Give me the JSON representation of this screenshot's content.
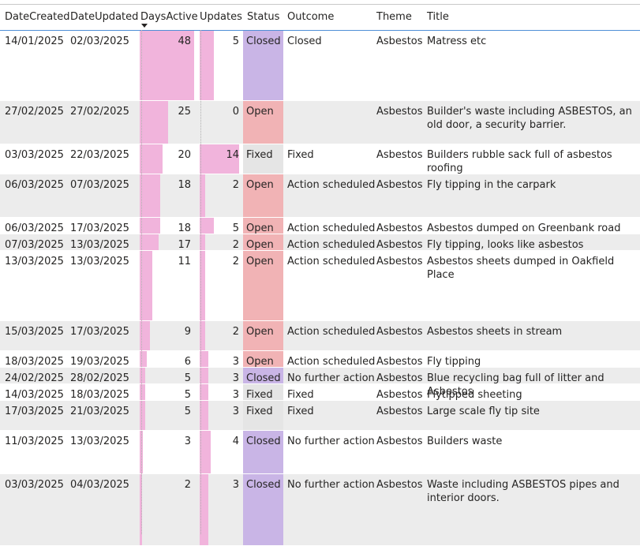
{
  "colors": {
    "bar": "#f1b4dc",
    "status_closed": "#c9b5e6",
    "status_open": "#f1b3b5",
    "status_fixed": "#e5e5e5",
    "row_alt": "#ececec",
    "header_rule": "#4f8fd6"
  },
  "headers": {
    "date_created": "DateCreated",
    "date_updated": "DateUpdated",
    "days_active": "DaysActive",
    "updates": "Updates",
    "status": "Status",
    "outcome": "Outcome",
    "theme": "Theme",
    "title": "Title"
  },
  "sort_indicator": "chevron-down-icon",
  "rows": [
    {
      "date_created": "14/01/2025",
      "date_updated": "02/03/2025",
      "days_active": "48",
      "updates": "5",
      "status": "Closed",
      "outcome": "Closed",
      "theme": "Asbestos",
      "title": "Matress etc"
    },
    {
      "date_created": "27/02/2025",
      "date_updated": "27/02/2025",
      "days_active": "25",
      "updates": "0",
      "status": "Open",
      "outcome": "",
      "theme": "Asbestos",
      "title": "Builder's waste including ASBESTOS, an old door, a security barrier."
    },
    {
      "date_created": "03/03/2025",
      "date_updated": "22/03/2025",
      "days_active": "20",
      "updates": "14",
      "status": "Fixed",
      "outcome": "Fixed",
      "theme": "Asbestos",
      "title": "Builders rubble sack full of asbestos roofing"
    },
    {
      "date_created": "06/03/2025",
      "date_updated": "07/03/2025",
      "days_active": "18",
      "updates": "2",
      "status": "Open",
      "outcome": "Action scheduled",
      "theme": "Asbestos",
      "title": "Fly tipping in the carpark"
    },
    {
      "date_created": "06/03/2025",
      "date_updated": "17/03/2025",
      "days_active": "18",
      "updates": "5",
      "status": "Open",
      "outcome": "Action scheduled",
      "theme": "Asbestos",
      "title": "Asbestos dumped on Greenbank road"
    },
    {
      "date_created": "07/03/2025",
      "date_updated": "13/03/2025",
      "days_active": "17",
      "updates": "2",
      "status": "Open",
      "outcome": "Action scheduled",
      "theme": "Asbestos",
      "title": "Fly tipping, looks like asbestos"
    },
    {
      "date_created": "13/03/2025",
      "date_updated": "13/03/2025",
      "days_active": "11",
      "updates": "2",
      "status": "Open",
      "outcome": "Action scheduled",
      "theme": "Asbestos",
      "title": "Asbestos sheets dumped in Oakfield Place"
    },
    {
      "date_created": "15/03/2025",
      "date_updated": "17/03/2025",
      "days_active": "9",
      "updates": "2",
      "status": "Open",
      "outcome": "Action scheduled",
      "theme": "Asbestos",
      "title": "Asbestos sheets in stream"
    },
    {
      "date_created": "18/03/2025",
      "date_updated": "19/03/2025",
      "days_active": "6",
      "updates": "3",
      "status": "Open",
      "outcome": "Action scheduled",
      "theme": "Asbestos",
      "title": "Fly tipping"
    },
    {
      "date_created": "24/02/2025",
      "date_updated": "28/02/2025",
      "days_active": "5",
      "updates": "3",
      "status": "Closed",
      "outcome": "No further action",
      "theme": "Asbestos",
      "title": "Blue recycling bag full of litter and Asbestos"
    },
    {
      "date_created": "14/03/2025",
      "date_updated": "18/03/2025",
      "days_active": "5",
      "updates": "3",
      "status": "Fixed",
      "outcome": "Fixed",
      "theme": "Asbestos",
      "title": "Flytipped sheeting"
    },
    {
      "date_created": "17/03/2025",
      "date_updated": "21/03/2025",
      "days_active": "5",
      "updates": "3",
      "status": "Fixed",
      "outcome": "Fixed",
      "theme": "Asbestos",
      "title": "Large scale fly tip site"
    },
    {
      "date_created": "11/03/2025",
      "date_updated": "13/03/2025",
      "days_active": "3",
      "updates": "4",
      "status": "Closed",
      "outcome": "No further action",
      "theme": "Asbestos",
      "title": "Builders waste"
    },
    {
      "date_created": "03/03/2025",
      "date_updated": "04/03/2025",
      "days_active": "2",
      "updates": "3",
      "status": "Closed",
      "outcome": "No further action",
      "theme": "Asbestos",
      "title": "Waste including ASBESTOS pipes and interior doors."
    }
  ]
}
